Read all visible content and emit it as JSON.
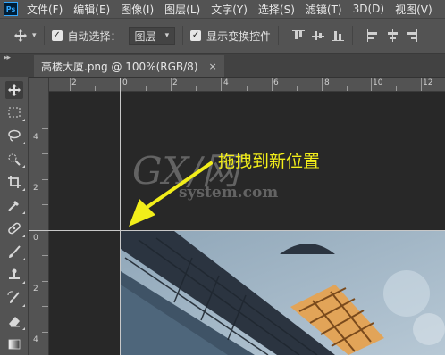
{
  "app": {
    "logo_text": "Ps"
  },
  "menu": [
    "文件(F)",
    "编辑(E)",
    "图像(I)",
    "图层(L)",
    "文字(Y)",
    "选择(S)",
    "滤镜(T)",
    "3D(D)",
    "视图(V)"
  ],
  "options": {
    "auto_select_label": "自动选择：",
    "auto_select_checked": true,
    "layer_select_value": "图层",
    "show_transform_label": "显示变换控件",
    "show_transform_checked": true
  },
  "document_tab": {
    "title": "高楼大厦.png @ 100%(RGB/8)",
    "close_glyph": "×"
  },
  "rulers": {
    "top_labels": [
      "2",
      "0",
      "2",
      "4",
      "6",
      "8",
      "10",
      "12"
    ],
    "left_labels": [
      "4",
      "2",
      "0",
      "2",
      "4"
    ]
  },
  "annotation": {
    "text": "拖拽到新位置",
    "color": "#f2ee1a"
  },
  "watermark": {
    "big": "GX/网",
    "small": "system.com"
  },
  "tools": [
    "move-tool",
    "rect-marquee-tool",
    "lasso-tool",
    "quick-select-tool",
    "crop-tool",
    "eyedropper-tool",
    "healing-brush-tool",
    "brush-tool",
    "clone-stamp-tool",
    "history-brush-tool",
    "eraser-tool",
    "gradient-tool"
  ],
  "colors": {
    "ui_gray": "#535353",
    "canvas_bg": "#282828",
    "guide": "#c8c8c8",
    "accent": "#31a8ff"
  }
}
